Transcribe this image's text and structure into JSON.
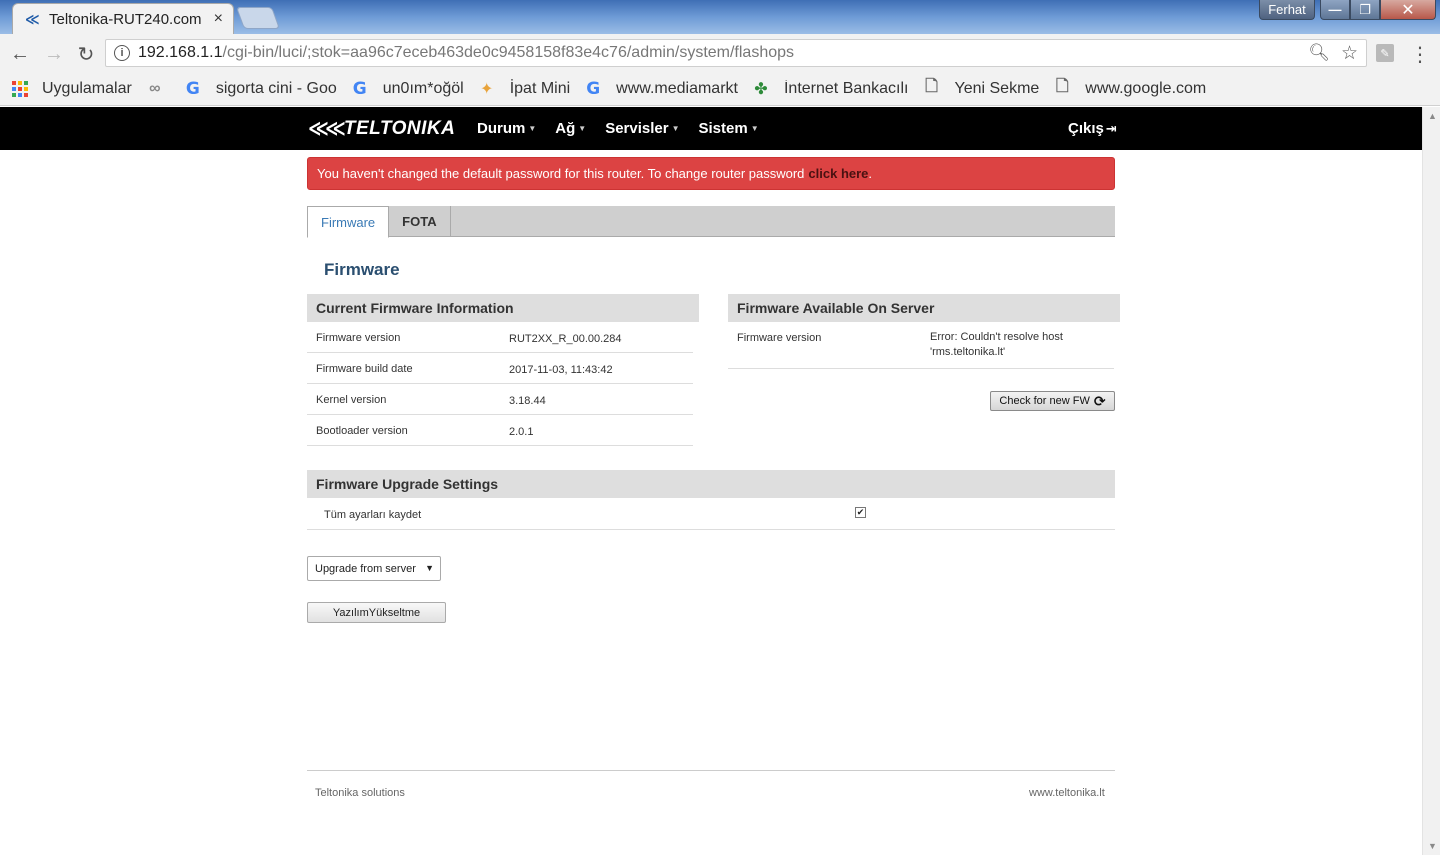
{
  "browser": {
    "tab_title": "Teltonika-RUT240.com",
    "tab_close": "×",
    "profile_name": "Ferhat",
    "url_host": "192.168.1.1",
    "url_path": "/cgi-bin/luci/;stok=aa96c7eceb463de0c9458158f83e4c76/admin/system/flashops",
    "bookmarks": [
      {
        "label": "Uygulamalar",
        "icon": "apps-grid-icon"
      },
      {
        "label": "",
        "icon": "glasses-icon"
      },
      {
        "label": "sigorta cini - Goo",
        "icon": "google-icon"
      },
      {
        "label": "un0ım*oğöl",
        "icon": "google-icon"
      },
      {
        "label": "İpat Mini",
        "icon": "pinwheel-icon"
      },
      {
        "label": "www.mediamarkt",
        "icon": "google-icon"
      },
      {
        "label": "İnternet Bankacılı",
        "icon": "clover-icon"
      },
      {
        "label": "Yeni Sekme",
        "icon": "page-icon"
      },
      {
        "label": "www.google.com",
        "icon": "page-icon"
      }
    ]
  },
  "navbar": {
    "brand": "TELTONIKA",
    "menu": [
      "Durum",
      "Ağ",
      "Servisler",
      "Sistem"
    ],
    "logout": "Çıkış"
  },
  "alert": {
    "message": "You haven't changed the default password for this router. To change router password",
    "link": "click here",
    "tail": "."
  },
  "tabs": [
    "Firmware",
    "FOTA"
  ],
  "section_title": "Firmware",
  "current_fw": {
    "title": "Current Firmware Information",
    "rows": [
      {
        "key": "Firmware version",
        "value": "RUT2XX_R_00.00.284"
      },
      {
        "key": "Firmware build date",
        "value": "2017-11-03, 11:43:42"
      },
      {
        "key": "Kernel version",
        "value": "3.18.44"
      },
      {
        "key": "Bootloader version",
        "value": "2.0.1"
      }
    ]
  },
  "server_fw": {
    "title": "Firmware Available On Server",
    "key": "Firmware version",
    "value": "Error: Couldn't resolve host 'rms.teltonika.lt'",
    "check_button": "Check for new FW"
  },
  "upgrade_settings": {
    "title": "Firmware Upgrade Settings",
    "keep_settings_label": "Tüm ayarları kaydet",
    "keep_settings_checked": true,
    "select_value": "Upgrade from server",
    "upgrade_button": "YazılımYükseltme"
  },
  "footer": {
    "left": "Teltonika solutions",
    "right": "www.teltonika.lt"
  },
  "colors": {
    "alert_bg": "#dc4343",
    "navbar_bg": "#000000",
    "active_tab_text": "#3a7ab5",
    "section_title": "#2b4f70"
  }
}
